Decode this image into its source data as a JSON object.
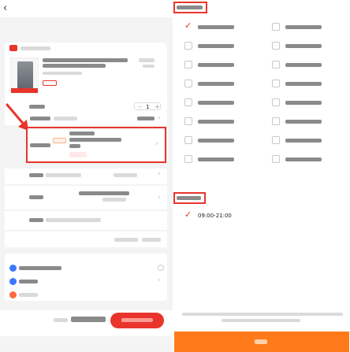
{
  "header": {
    "back_icon": "chevron-left-icon",
    "title": ""
  },
  "order": {
    "store_name": "",
    "product_title": "",
    "product_spec": "",
    "product_tag": "",
    "line_item_label": "",
    "quantity": "1",
    "delivery_label": "",
    "delivery_value": "",
    "install_label": "",
    "install_tag": "",
    "install_summary": "",
    "install_badge": ""
  },
  "panel": {
    "date_section_title": "",
    "time_section_title": "",
    "dates": [
      {
        "label": "",
        "selected": true
      },
      {
        "label": "",
        "selected": false
      },
      {
        "label": "",
        "selected": false
      },
      {
        "label": "",
        "selected": false
      },
      {
        "label": "",
        "selected": false
      },
      {
        "label": "",
        "selected": false
      },
      {
        "label": "",
        "selected": false
      },
      {
        "label": "",
        "selected": false
      },
      {
        "label": "",
        "selected": false
      },
      {
        "label": "",
        "selected": false
      },
      {
        "label": "",
        "selected": false
      },
      {
        "label": "",
        "selected": false
      },
      {
        "label": "",
        "selected": false
      },
      {
        "label": "",
        "selected": false
      },
      {
        "label": "",
        "selected": false
      },
      {
        "label": "",
        "selected": false
      }
    ],
    "times": [
      {
        "label": "09:00-21:00",
        "selected": true
      }
    ],
    "notice": "",
    "confirm_label": ""
  },
  "footer": {
    "total_price": "",
    "submit_label": ""
  },
  "colors": {
    "accent": "#e8342c",
    "orange": "#ff7a1a",
    "bg_gray": "#f4f4f4",
    "selected_bg": "#fff0e6"
  }
}
